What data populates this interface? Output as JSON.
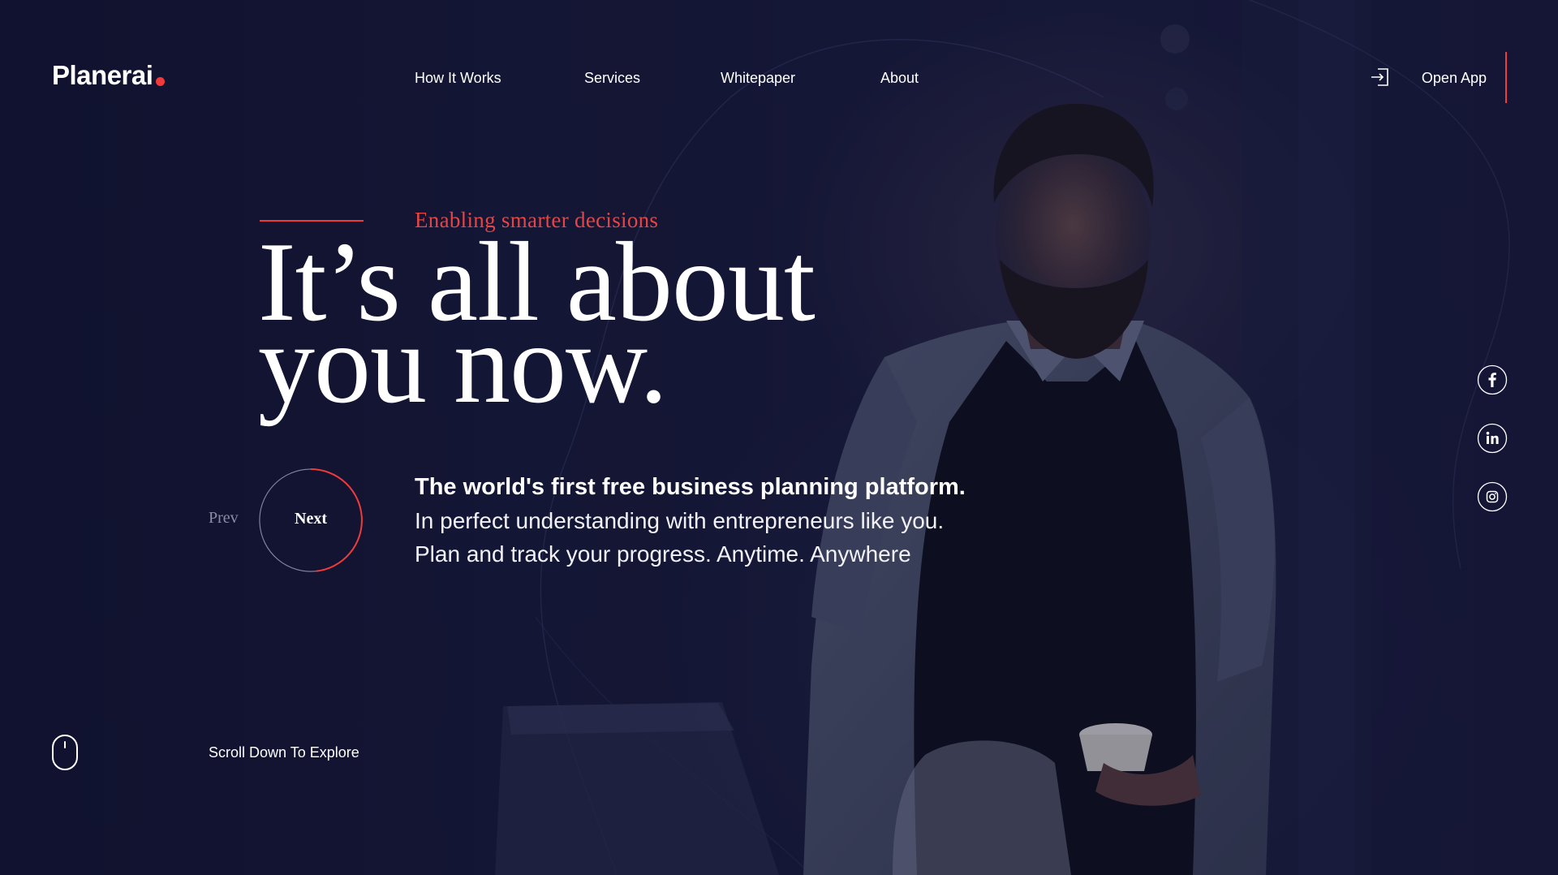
{
  "brand": {
    "name": "Planerai",
    "dot_color": "#ef3b3b"
  },
  "nav": {
    "items": [
      {
        "label": "How  It Works"
      },
      {
        "label": "Services"
      },
      {
        "label": "Whitepaper"
      },
      {
        "label": "About"
      }
    ],
    "open_app_label": "Open App",
    "open_app_icon": "login-icon"
  },
  "hero": {
    "eyebrow": "Enabling smarter decisions",
    "headline_line1": "It’s all about",
    "headline_line2": "you now.",
    "tagline_bold": "The world's first free business planning platform.",
    "tagline_line2": "In perfect understanding with entrepreneurs like you.",
    "tagline_line3": "Plan and track your progress. Anytime. Anywhere"
  },
  "slider": {
    "prev_label": "Prev",
    "next_label": "Next"
  },
  "social": [
    {
      "icon": "facebook-icon",
      "glyph": "f"
    },
    {
      "icon": "linkedin-icon",
      "glyph": "in"
    },
    {
      "icon": "instagram-icon",
      "glyph": ""
    }
  ],
  "scroll": {
    "label": "Scroll Down To Explore",
    "icon": "mouse-icon"
  },
  "colors": {
    "accent": "#ef3b3b",
    "background": "#141534",
    "text": "#ffffff",
    "muted": "#8c8ca4"
  }
}
